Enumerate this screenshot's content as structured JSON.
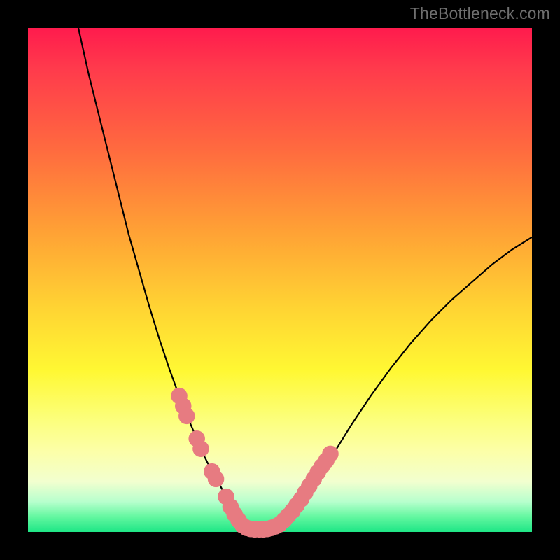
{
  "watermark": "TheBottleneck.com",
  "colors": {
    "curve_stroke": "#000000",
    "bead_fill": "#e77b81",
    "bead_stroke": "#e77b81"
  },
  "chart_data": {
    "type": "line",
    "title": "",
    "xlabel": "",
    "ylabel": "",
    "xlim": [
      0,
      100
    ],
    "ylim": [
      0,
      100
    ],
    "grid": false,
    "series": [
      {
        "name": "bottleneck-curve",
        "x": [
          10,
          12,
          14,
          16,
          18,
          20,
          22,
          24,
          26,
          28,
          30,
          32,
          33.5,
          35,
          36.5,
          38,
          39,
          40,
          41,
          42,
          43,
          44,
          46,
          48,
          50,
          52,
          54,
          56,
          58,
          60,
          64,
          68,
          72,
          76,
          80,
          84,
          88,
          92,
          96,
          100
        ],
        "y": [
          100,
          91,
          83,
          75,
          67,
          59,
          52,
          45,
          38.5,
          32.5,
          27,
          22,
          18.5,
          15,
          12,
          9.5,
          7.5,
          5.5,
          3.5,
          2,
          1,
          0.5,
          0.5,
          0.8,
          1.5,
          3,
          5.5,
          8.5,
          11.5,
          14.5,
          21,
          27,
          32.5,
          37.5,
          42,
          46,
          49.5,
          53,
          56,
          58.5
        ]
      }
    ],
    "beads": {
      "name": "markers",
      "points": [
        {
          "x": 30.0,
          "y": 27.0,
          "r": 1.2
        },
        {
          "x": 30.8,
          "y": 25.0,
          "r": 1.2
        },
        {
          "x": 31.5,
          "y": 23.0,
          "r": 1.2
        },
        {
          "x": 33.5,
          "y": 18.5,
          "r": 1.2
        },
        {
          "x": 34.3,
          "y": 16.5,
          "r": 1.2
        },
        {
          "x": 36.5,
          "y": 12.0,
          "r": 1.2
        },
        {
          "x": 37.3,
          "y": 10.5,
          "r": 1.2
        },
        {
          "x": 39.3,
          "y": 7.0,
          "r": 1.2
        },
        {
          "x": 40.2,
          "y": 5.0,
          "r": 1.2
        },
        {
          "x": 41.0,
          "y": 3.5,
          "r": 1.2
        },
        {
          "x": 41.8,
          "y": 2.3,
          "r": 1.2
        },
        {
          "x": 42.6,
          "y": 1.3,
          "r": 1.2
        },
        {
          "x": 43.4,
          "y": 0.8,
          "r": 1.2
        },
        {
          "x": 44.2,
          "y": 0.6,
          "r": 1.2
        },
        {
          "x": 45.0,
          "y": 0.5,
          "r": 1.2
        },
        {
          "x": 45.9,
          "y": 0.5,
          "r": 1.2
        },
        {
          "x": 46.7,
          "y": 0.5,
          "r": 1.2
        },
        {
          "x": 47.5,
          "y": 0.6,
          "r": 1.2
        },
        {
          "x": 48.3,
          "y": 0.8,
          "r": 1.2
        },
        {
          "x": 49.1,
          "y": 1.1,
          "r": 1.2
        },
        {
          "x": 49.9,
          "y": 1.5,
          "r": 1.2
        },
        {
          "x": 50.8,
          "y": 2.3,
          "r": 1.2
        },
        {
          "x": 51.6,
          "y": 3.2,
          "r": 1.2
        },
        {
          "x": 52.5,
          "y": 4.2,
          "r": 1.2
        },
        {
          "x": 53.3,
          "y": 5.3,
          "r": 1.2
        },
        {
          "x": 54.2,
          "y": 6.5,
          "r": 1.2
        },
        {
          "x": 55.0,
          "y": 7.8,
          "r": 1.2
        },
        {
          "x": 55.8,
          "y": 9.1,
          "r": 1.2
        },
        {
          "x": 56.7,
          "y": 10.5,
          "r": 1.2
        },
        {
          "x": 57.5,
          "y": 11.8,
          "r": 1.2
        },
        {
          "x": 58.3,
          "y": 13.0,
          "r": 1.2
        },
        {
          "x": 59.2,
          "y": 14.2,
          "r": 1.2
        },
        {
          "x": 60.0,
          "y": 15.5,
          "r": 1.2
        }
      ]
    }
  }
}
